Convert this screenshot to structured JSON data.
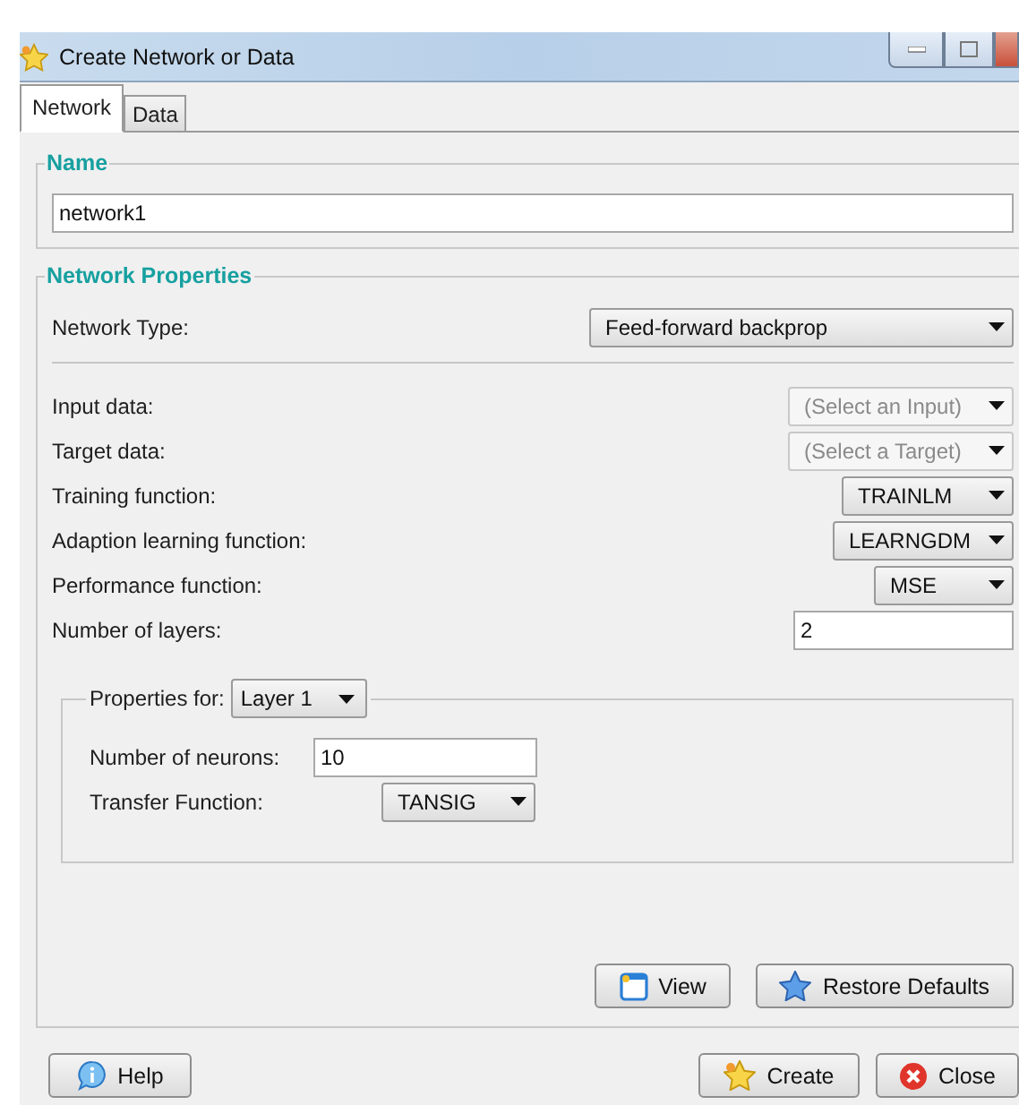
{
  "window": {
    "title": "Create Network or Data"
  },
  "tabs": [
    {
      "label": "Network",
      "selected": true
    },
    {
      "label": "Data",
      "selected": false
    }
  ],
  "name_group": {
    "legend": "Name",
    "value": "network1"
  },
  "network_properties": {
    "legend": "Network Properties",
    "network_type": {
      "label": "Network Type:",
      "value": "Feed-forward backprop"
    },
    "fields": [
      {
        "label": "Input data:",
        "kind": "select",
        "value": "(Select an Input)",
        "disabled": true
      },
      {
        "label": "Target data:",
        "kind": "select",
        "value": "(Select a Target)",
        "disabled": true
      },
      {
        "label": "Training function:",
        "kind": "select",
        "value": "TRAINLM",
        "disabled": false
      },
      {
        "label": "Adaption learning function:",
        "kind": "select",
        "value": "LEARNGDM",
        "disabled": false
      },
      {
        "label": "Performance function:",
        "kind": "select",
        "value": "MSE",
        "disabled": false
      },
      {
        "label": "Number of layers:",
        "kind": "text",
        "value": "2"
      }
    ],
    "layer_properties": {
      "label": "Properties for:",
      "layer": "Layer 1",
      "fields": [
        {
          "label": "Number of neurons:",
          "kind": "text",
          "value": "10"
        },
        {
          "label": "Transfer Function:",
          "kind": "select",
          "value": "TANSIG"
        }
      ]
    },
    "buttons": [
      {
        "label": "View"
      },
      {
        "label": "Restore Defaults"
      }
    ]
  },
  "footer_buttons": [
    {
      "label": "Help"
    },
    {
      "label": "Create"
    },
    {
      "label": "Close"
    }
  ]
}
